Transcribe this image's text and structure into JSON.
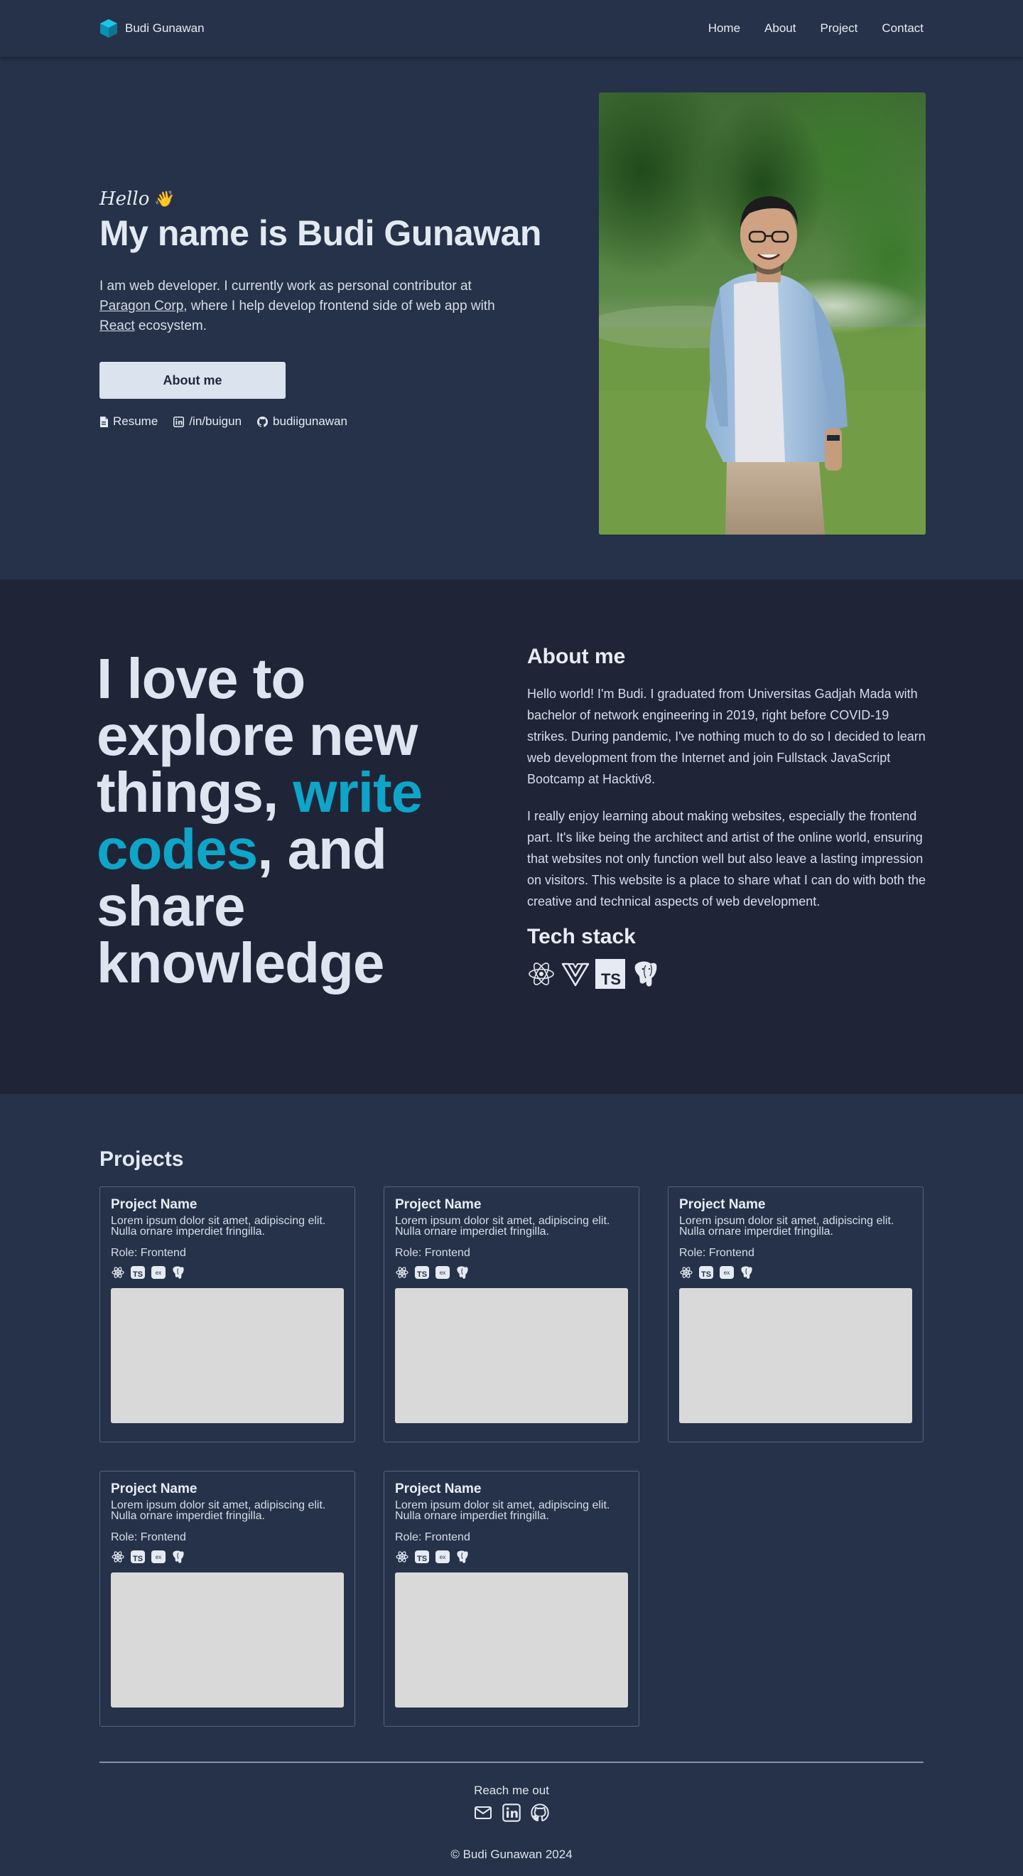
{
  "nav": {
    "brand": "Budi Gunawan",
    "links": [
      "Home",
      "About",
      "Project",
      "Contact"
    ]
  },
  "hero": {
    "greeting": "Hello",
    "greeting_emoji": "👋",
    "title": "My name is Budi Gunawan",
    "desc_part1": "I am web developer. I currently work as personal contributor at ",
    "desc_link1": "Paragon Corp",
    "desc_part2": ", where I help develop frontend side of web app with ",
    "desc_link2": "React",
    "desc_part3": " ecosystem.",
    "button_label": "About me",
    "links": {
      "resume": "Resume",
      "linkedin": "/in/buigun",
      "github": "budiigunawan"
    }
  },
  "about": {
    "quote_1": "I love to explore new things, ",
    "quote_accent_1": "write codes",
    "quote_2": ", and share knowledge",
    "title": "About me",
    "paragraph_1": "Hello world! I'm Budi. I graduated from Universitas Gadjah Mada with bachelor of network engineering in 2019, right before COVID-19 strikes. During pandemic, I've nothing much to do so I decided to learn web development from the Internet and join Fullstack JavaScript Bootcamp at Hacktiv8.",
    "paragraph_2": "I really enjoy learning about making websites, especially the frontend part. It's like being the architect and artist of the online world, ensuring that websites not only function well but also leave a lasting impression on visitors. This website is a place to share what I can do with both the creative and technical aspects of web development.",
    "tech_title": "Tech stack",
    "tech_icons": [
      "react-icon",
      "vue-icon",
      "typescript-icon",
      "postgresql-icon"
    ]
  },
  "projects": {
    "title": "Projects",
    "items": [
      {
        "name": "Project Name",
        "desc": "Lorem ipsum dolor sit amet, adipiscing elit. Nulla ornare imperdiet fringilla.",
        "role": "Role: Frontend"
      },
      {
        "name": "Project Name",
        "desc": "Lorem ipsum dolor sit amet, adipiscing elit. Nulla ornare imperdiet fringilla.",
        "role": "Role: Frontend"
      },
      {
        "name": "Project Name",
        "desc": "Lorem ipsum dolor sit amet, adipiscing elit. Nulla ornare imperdiet fringilla.",
        "role": "Role: Frontend"
      },
      {
        "name": "Project Name",
        "desc": "Lorem ipsum dolor sit amet, adipiscing elit. Nulla ornare imperdiet fringilla.",
        "role": "Role: Frontend"
      },
      {
        "name": "Project Name",
        "desc": "Lorem ipsum dolor sit amet, adipiscing elit. Nulla ornare imperdiet fringilla.",
        "role": "Role: Frontend"
      }
    ]
  },
  "footer": {
    "reach": "Reach me out",
    "copyright": "© Budi Gunawan 2024"
  },
  "colors": {
    "background": "#263249",
    "about_background": "#1f2537",
    "accent": "#0ea5c9",
    "button": "#dbe3ee"
  }
}
